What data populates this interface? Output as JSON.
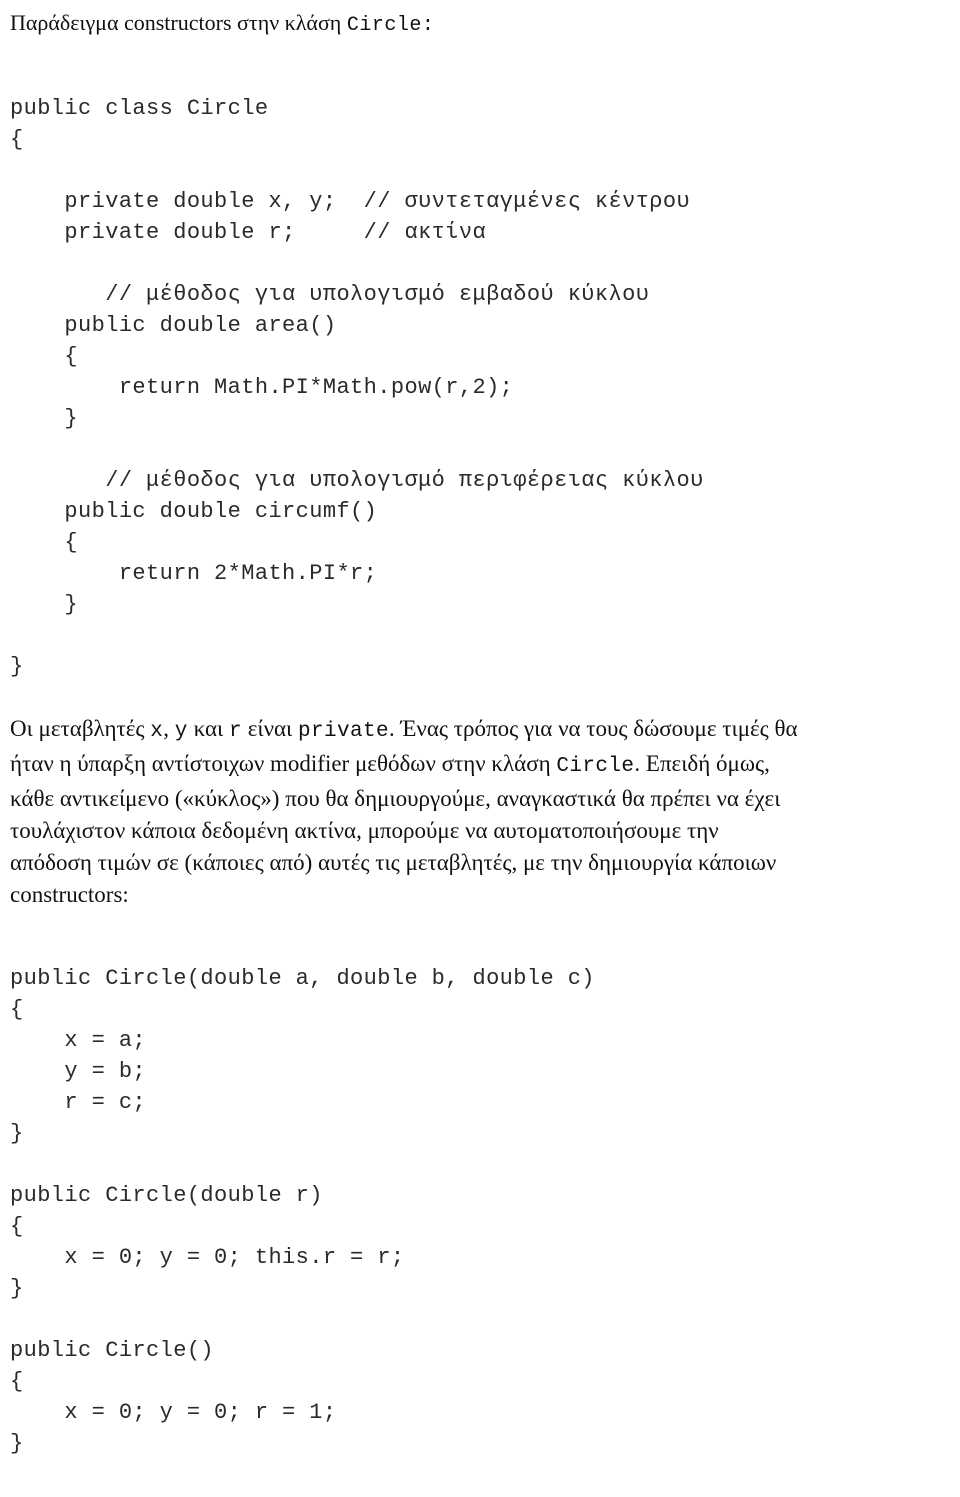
{
  "document": {
    "language": "el",
    "background_color": "#ffffff",
    "text_color": "#111111",
    "code_color": "#2a2a2a"
  },
  "intro": {
    "prose_before": "Παράδειγμα constructors στην κλάση ",
    "code_token": "Circle:"
  },
  "class_code": {
    "lines": [
      "public class Circle",
      "{",
      "",
      "    private double x, y;  // συντεταγμένες κέντρου",
      "    private double r;     // ακτίνα",
      "",
      "       // μέθοδος για υπολογισμό εμβαδού κύκλου",
      "    public double area()",
      "    {",
      "        return Math.PI*Math.pow(r,2);",
      "    }",
      "",
      "       // μέθοδος για υπολογισμό περιφέρειας κύκλου",
      "    public double circumf()",
      "    {",
      "        return 2*Math.PI*r;",
      "    }",
      "",
      "}"
    ]
  },
  "paragraph": {
    "lines": [
      [
        {
          "type": "text",
          "value": "Οι μεταβλητές "
        },
        {
          "type": "code",
          "value": "x"
        },
        {
          "type": "text",
          "value": ", "
        },
        {
          "type": "code",
          "value": "y"
        },
        {
          "type": "text",
          "value": " και "
        },
        {
          "type": "code",
          "value": "r"
        },
        {
          "type": "text",
          "value": " είναι "
        },
        {
          "type": "code",
          "value": "private"
        },
        {
          "type": "text",
          "value": ". Ένας τρόπος για να τους δώσουμε τιμές θα"
        }
      ],
      [
        {
          "type": "text",
          "value": "ήταν η ύπαρξη αντίστοιχων modifier μεθόδων στην κλάση "
        },
        {
          "type": "code",
          "value": "Circle"
        },
        {
          "type": "text",
          "value": ". Επειδή όμως,"
        }
      ],
      [
        {
          "type": "text",
          "value": "κάθε αντικείμενο («κύκλος») που θα δημιουργούμε, αναγκαστικά θα πρέπει να έχει"
        }
      ],
      [
        {
          "type": "text",
          "value": "τουλάχιστον κάποια δεδομένη ακτίνα, μπορούμε να αυτοματοποιήσουμε την"
        }
      ],
      [
        {
          "type": "text",
          "value": "απόδοση τιμών σε (κάποιες από) αυτές τις μεταβλητές, με την δημιουργία κάποιων"
        }
      ],
      [
        {
          "type": "text",
          "value": "constructors:"
        }
      ]
    ],
    "plain_text": "Οι μεταβλητές x, y και r είναι private. Ένας τρόπος για να τους δώσουμε τιμές θα ήταν η ύπαρξη αντίστοιχων modifier μεθόδων στην κλάση Circle. Επειδή όμως, κάθε αντικείμενο («κύκλος») που θα δημιουργούμε, αναγκαστικά θα πρέπει να έχει τουλάχιστον κάποια δεδομένη ακτίνα, μπορούμε να αυτοματοποιήσουμε την απόδοση τιμών σε (κάποιες από) αυτές τις μεταβλητές, με την δημιουργία κάποιων constructors:"
  },
  "constructor_code_1": {
    "lines": [
      "public Circle(double a, double b, double c)",
      "{",
      "    x = a;",
      "    y = b;",
      "    r = c;",
      "}"
    ]
  },
  "constructor_code_2": {
    "lines": [
      "public Circle(double r)",
      "{",
      "    x = 0; y = 0; this.r = r;",
      "}"
    ]
  },
  "constructor_code_3": {
    "lines": [
      "public Circle()",
      "{",
      "    x = 0; y = 0; r = 1;",
      "}"
    ]
  }
}
